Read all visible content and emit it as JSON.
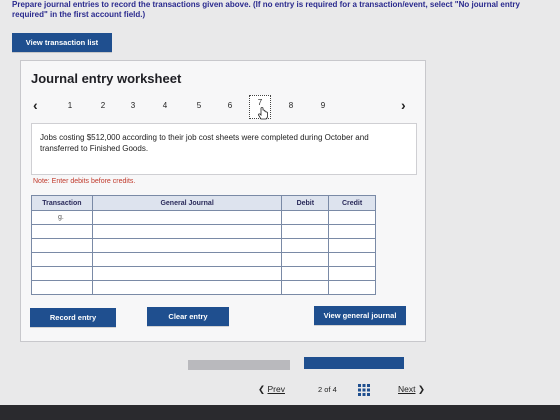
{
  "instructions": {
    "text": "Prepare journal entries to record the transactions given above. (If no entry is required for a transaction/event, select \"No journal entry required\" in the first account field.)"
  },
  "buttons": {
    "view_transaction_list": "View transaction list",
    "record_entry": "Record entry",
    "clear_entry": "Clear entry",
    "view_general_journal": "View general journal"
  },
  "worksheet": {
    "title": "Journal entry worksheet",
    "pager": {
      "prev_arrow": "‹",
      "next_arrow": "›",
      "pages": [
        "1",
        "2",
        "3",
        "4",
        "5",
        "6",
        "7",
        "8",
        "9"
      ],
      "current": "7"
    },
    "problem": "Jobs costing $512,000 according to their job cost sheets were completed during October and transferred to Finished Goods.",
    "note": "Note: Enter debits before credits.",
    "table": {
      "headers": [
        "Transaction",
        "General Journal",
        "Debit",
        "Credit"
      ],
      "rows": [
        [
          "g.",
          "",
          "",
          ""
        ],
        [
          "",
          "",
          "",
          ""
        ],
        [
          "",
          "",
          "",
          ""
        ],
        [
          "",
          "",
          "",
          ""
        ],
        [
          "",
          "",
          "",
          ""
        ],
        [
          "",
          "",
          "",
          ""
        ]
      ]
    }
  },
  "footer": {
    "prev": "Prev",
    "page_current": "2",
    "page_of": "of",
    "page_total": "4",
    "next": "Next"
  },
  "colors": {
    "accent": "#1f4f8f",
    "note": "#c0392b"
  }
}
